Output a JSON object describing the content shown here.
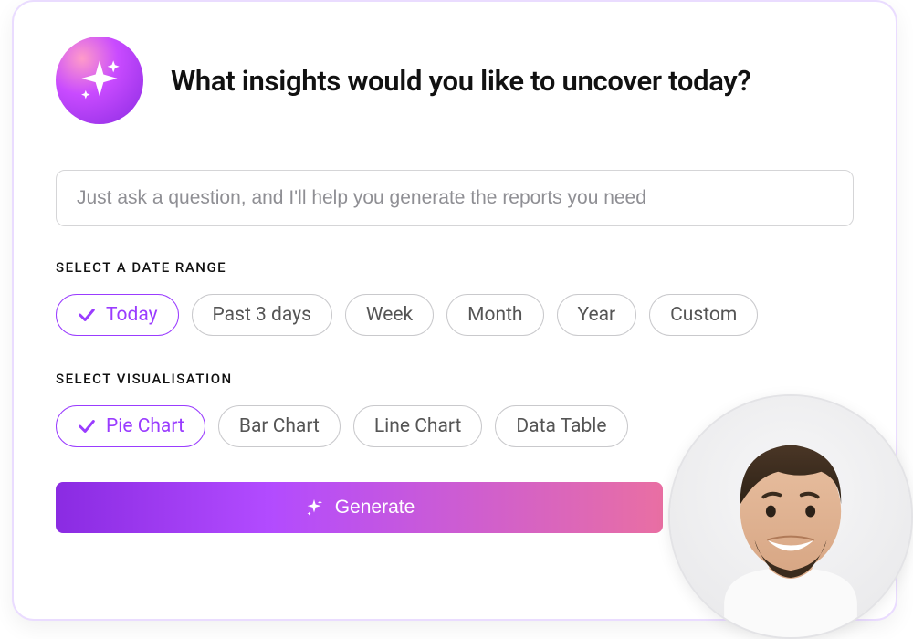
{
  "header": {
    "title": "What insights would you like to uncover today?"
  },
  "input": {
    "placeholder": "Just ask a question, and I'll help you generate the reports you need"
  },
  "date_range": {
    "label": "SELECT A DATE RANGE",
    "options": [
      "Today",
      "Past 3 days",
      "Week",
      "Month",
      "Year",
      "Custom"
    ],
    "selected": "Today"
  },
  "visualisation": {
    "label": "SELECT VISUALISATION",
    "options": [
      "Pie Chart",
      "Bar Chart",
      "Line Chart",
      "Data Table"
    ],
    "selected": "Pie Chart"
  },
  "generate_button": {
    "label": "Generate"
  }
}
